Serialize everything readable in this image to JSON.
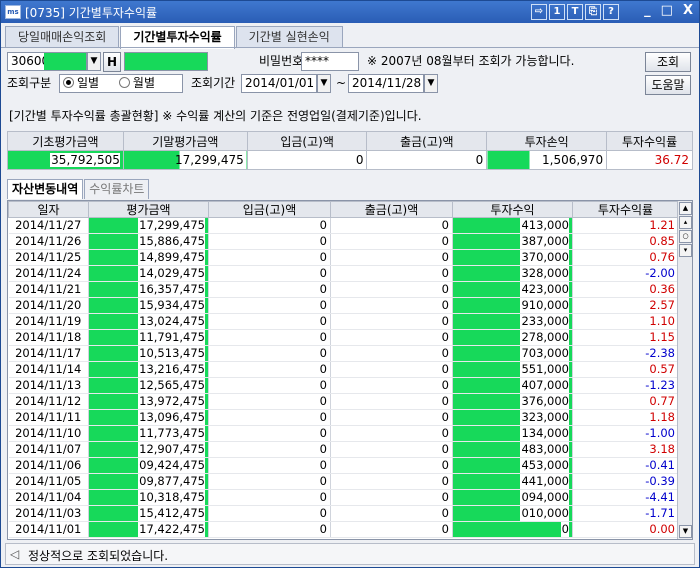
{
  "window": {
    "title": "[0735] 기간별투자수익률",
    "app_icon_text": "ms",
    "toolbar_buttons": [
      "⇨",
      "1",
      "T",
      "⎘",
      "?"
    ],
    "window_controls": [
      "_",
      "□",
      "X"
    ]
  },
  "tabs": [
    {
      "label": "당일매매손익조회",
      "active": false
    },
    {
      "label": "기간별투자수익률",
      "active": true
    },
    {
      "label": "기간별 실현손익",
      "active": false
    }
  ],
  "account": {
    "number_prefix": "30600",
    "h_button": "H",
    "password_label": "비밀번호",
    "password_value": "****",
    "notice": "※ 2007년 08월부터 조회가 가능합니다.",
    "search_button": "조회"
  },
  "query": {
    "type_label": "조회구분",
    "daily_label": "일별",
    "monthly_label": "월별",
    "daily_selected": true,
    "period_label": "조회기간",
    "start_date": "2014/01/01",
    "tilde": "~",
    "end_date": "2014/11/28",
    "help_button": "도움말"
  },
  "summary_note": "[기간별 투자수익률 총괄현황] ※ 수익률 계산의 기준은 전영업일(결제기준)입니다.",
  "summary": {
    "headers": [
      "기초평가금액",
      "기말평가금액",
      "입금(고)액",
      "출금(고)액",
      "투자손익",
      "투자수익률"
    ],
    "values": [
      "35,792,505",
      "17,299,475",
      "0",
      "0",
      "1,506,970",
      "36.72"
    ]
  },
  "sub_tabs": [
    {
      "label": "자산변동내역",
      "active": true
    },
    {
      "label": "수익률차트",
      "active": false
    }
  ],
  "grid": {
    "headers": [
      "일자",
      "평가금액",
      "입금(고)액",
      "출금(고)액",
      "투자수익",
      "투자수익률"
    ],
    "rows": [
      [
        "2014/11/27",
        "17,299,475",
        "0",
        "0",
        "413,000",
        "1.21"
      ],
      [
        "2014/11/26",
        "15,886,475",
        "0",
        "0",
        "387,000",
        "0.85"
      ],
      [
        "2014/11/25",
        "14,899,475",
        "0",
        "0",
        "370,000",
        "0.76"
      ],
      [
        "2014/11/24",
        "14,029,475",
        "0",
        "0",
        "328,000",
        "-2.00"
      ],
      [
        "2014/11/21",
        "16,357,475",
        "0",
        "0",
        "423,000",
        "0.36"
      ],
      [
        "2014/11/20",
        "15,934,475",
        "0",
        "0",
        "910,000",
        "2.57"
      ],
      [
        "2014/11/19",
        "13,024,475",
        "0",
        "0",
        "233,000",
        "1.10"
      ],
      [
        "2014/11/18",
        "11,791,475",
        "0",
        "0",
        "278,000",
        "1.15"
      ],
      [
        "2014/11/17",
        "10,513,475",
        "0",
        "0",
        "703,000",
        "-2.38"
      ],
      [
        "2014/11/14",
        "13,216,475",
        "0",
        "0",
        "551,000",
        "0.57"
      ],
      [
        "2014/11/13",
        "12,565,475",
        "0",
        "0",
        "407,000",
        "-1.23"
      ],
      [
        "2014/11/12",
        "13,972,475",
        "0",
        "0",
        "376,000",
        "0.77"
      ],
      [
        "2014/11/11",
        "13,096,475",
        "0",
        "0",
        "323,000",
        "1.18"
      ],
      [
        "2014/11/10",
        "11,773,475",
        "0",
        "0",
        "134,000",
        "-1.00"
      ],
      [
        "2014/11/07",
        "12,907,475",
        "0",
        "0",
        "483,000",
        "3.18"
      ],
      [
        "2014/11/06",
        "09,424,475",
        "0",
        "0",
        "453,000",
        "-0.41"
      ],
      [
        "2014/11/05",
        "09,877,475",
        "0",
        "0",
        "441,000",
        "-0.39"
      ],
      [
        "2014/11/04",
        "10,318,475",
        "0",
        "0",
        "094,000",
        "-4.41"
      ],
      [
        "2014/11/03",
        "15,412,475",
        "0",
        "0",
        "010,000",
        "-1.71"
      ],
      [
        "2014/11/01",
        "17,422,475",
        "0",
        "0",
        "0",
        "0.00"
      ]
    ]
  },
  "status_message": "정상적으로 조회되었습니다.",
  "colors": {
    "mask_green": "#17d95a",
    "positive": "#d00000",
    "negative": "#0000cc"
  }
}
